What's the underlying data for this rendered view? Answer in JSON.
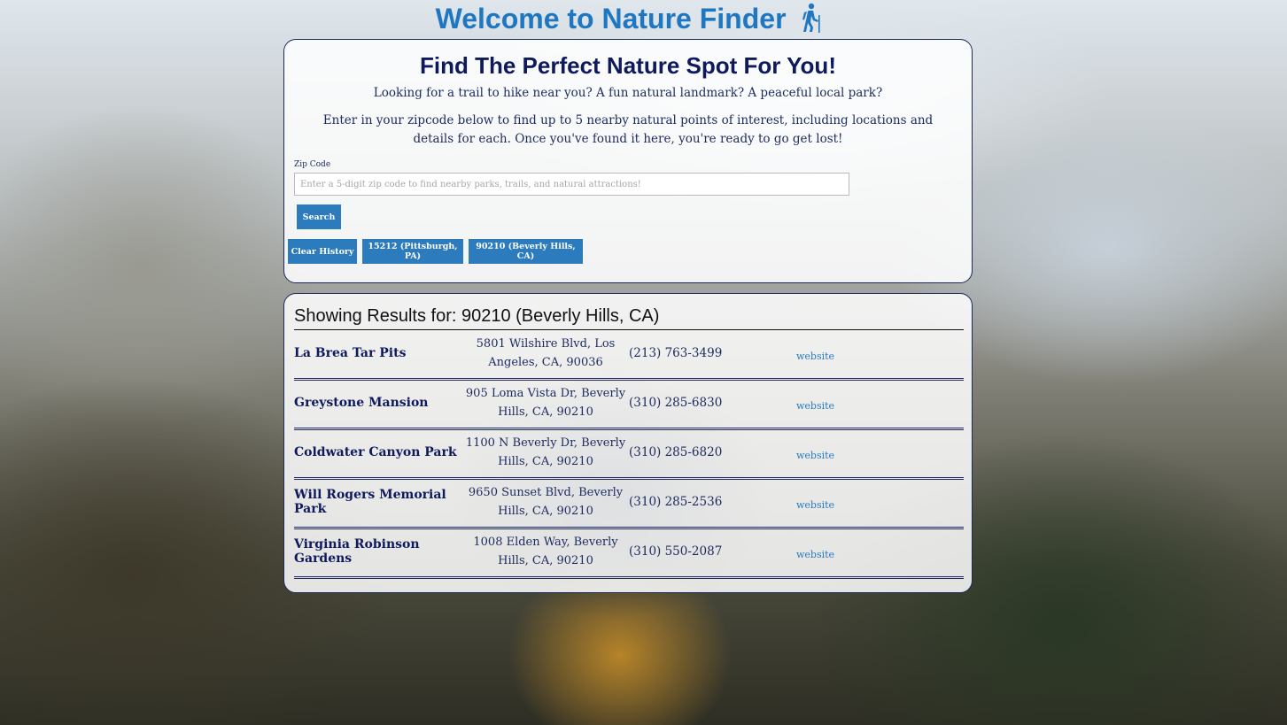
{
  "header": {
    "title": "Welcome to Nature Finder",
    "icon": "hiking-icon",
    "color": "#1e77c0"
  },
  "search_panel": {
    "heading": "Find The Perfect Nature Spot For You!",
    "intro_1": "Looking for a trail to hike near you? A fun natural landmark? A peaceful local park?",
    "intro_2": "Enter in your zipcode below to find up to 5 nearby natural points of interest, including locations and details for each. Once you've found it here, you're ready to go get lost!",
    "zip_label": "Zip Code",
    "zip_placeholder": "Enter a 5-digit zip code to find nearby parks, trails, and natural attractions!",
    "zip_value": "",
    "search_label": "Search",
    "clear_history_label": "Clear History",
    "history": [
      {
        "label": "15212 (Pittsburgh, PA)"
      },
      {
        "label": "90210 (Beverly Hills, CA)"
      }
    ],
    "button_color": "#2b7bbd"
  },
  "results_panel": {
    "heading": "Showing Results for: 90210 (Beverly Hills, CA)",
    "results": [
      {
        "name": "La Brea Tar Pits",
        "address": "5801 Wilshire Blvd, Los Angeles, CA, 90036",
        "phone": "(213) 763-3499",
        "website_label": "website"
      },
      {
        "name": "Greystone Mansion",
        "address": "905 Loma Vista Dr, Beverly Hills, CA, 90210",
        "phone": "(310) 285-6830",
        "website_label": "website"
      },
      {
        "name": "Coldwater Canyon Park",
        "address": "1100 N Beverly Dr, Beverly Hills, CA, 90210",
        "phone": "(310) 285-6820",
        "website_label": "website"
      },
      {
        "name": "Will Rogers Memorial Park",
        "address": "9650 Sunset Blvd, Beverly Hills, CA, 90210",
        "phone": "(310) 285-2536",
        "website_label": "website"
      },
      {
        "name": "Virginia Robinson Gardens",
        "address": "1008 Elden Way, Beverly Hills, CA, 90210",
        "phone": "(310) 550-2087",
        "website_label": "website"
      }
    ]
  }
}
